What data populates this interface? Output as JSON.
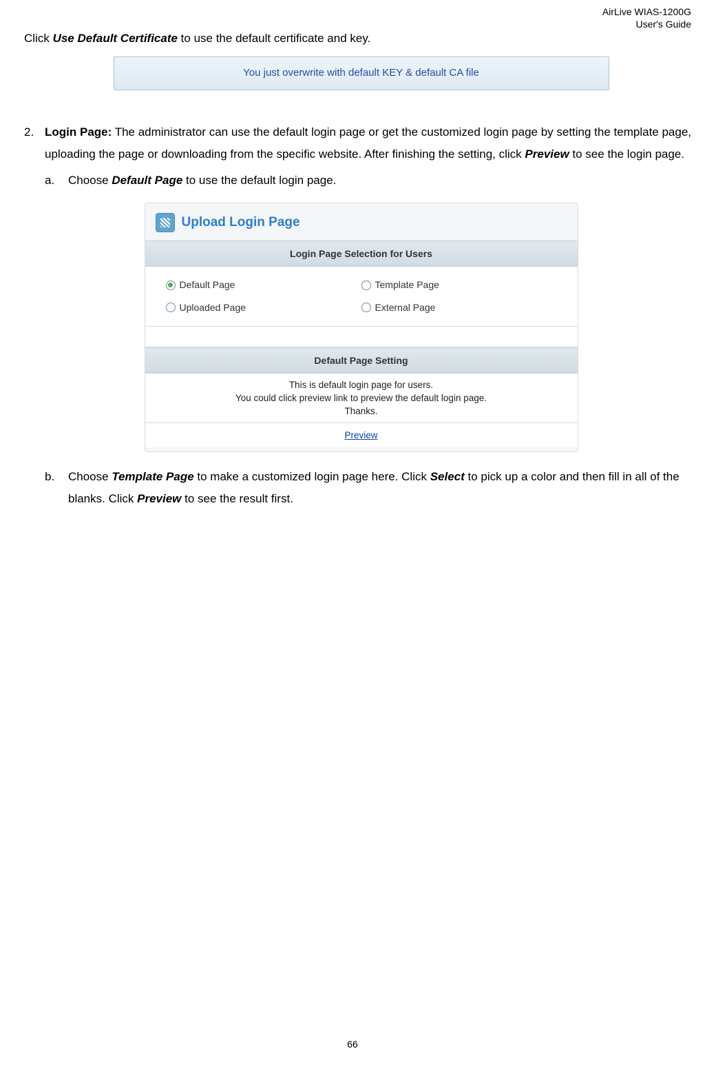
{
  "header": {
    "product": "AirLive WIAS-1200G",
    "doc": "User's Guide"
  },
  "body": {
    "p1_pre": "Click ",
    "p1_bold": "Use Default Certificate",
    "p1_post": " to use the default certificate and key.",
    "overwrite": "You just overwrite with default KEY & default CA file",
    "item2_num": "2.",
    "item2_bold": "Login Page:",
    "item2_text": " The administrator can use the default login page or get the customized login page by setting the template page, uploading the page or downloading from the specific website. After finishing the setting, click ",
    "item2_bold2": "Preview",
    "item2_text2": " to see the login page.",
    "item_a_num": "a.",
    "item_a_pre": "Choose ",
    "item_a_bold": "Default Page",
    "item_a_post": " to use the default login page.",
    "upload_title": "Upload Login Page",
    "panel_header1": "Login Page Selection for Users",
    "radios": {
      "default": "Default Page",
      "template": "Template Page",
      "uploaded": "Uploaded Page",
      "external": "External Page"
    },
    "panel_header2": "Default Page Setting",
    "default_msg_line1": "This is default login page for users.",
    "default_msg_line2": "You could click preview link to preview the default login page.",
    "default_msg_line3": "Thanks.",
    "preview": "Preview",
    "item_b_num": "b.",
    "item_b_pre": "Choose ",
    "item_b_bold": "Template Page",
    "item_b_mid": " to make a customized login page here. Click ",
    "item_b_bold2": "Select",
    "item_b_mid2": " to pick up a color and then fill in all of the blanks. Click ",
    "item_b_bold3": "Preview",
    "item_b_post": " to see the result first.",
    "page_num": "66"
  }
}
